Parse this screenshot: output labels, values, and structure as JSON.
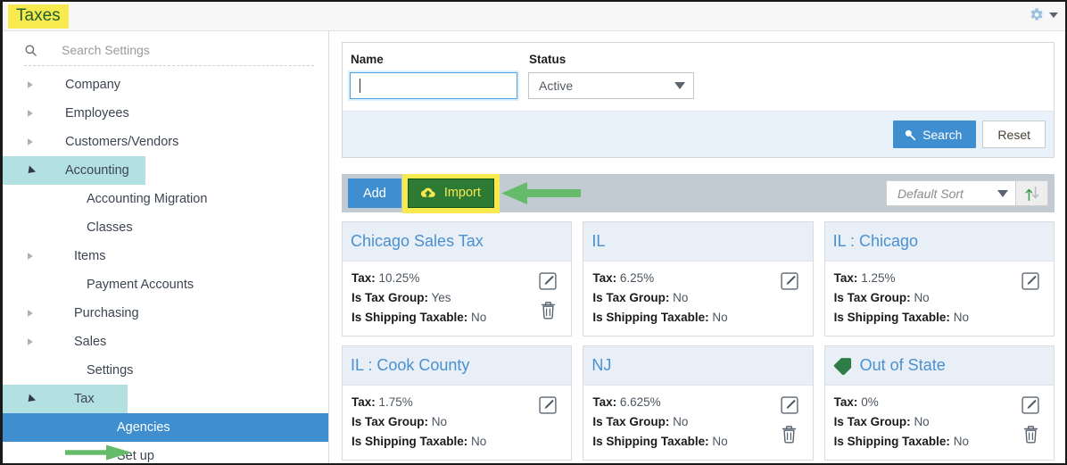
{
  "titlebar": {
    "title": "Taxes",
    "gear_icon": "gear-icon",
    "caret_icon": "chevron-down-icon"
  },
  "sidebar": {
    "search": {
      "icon": "search-icon",
      "placeholder": "Search Settings"
    },
    "items": [
      {
        "label": "Company",
        "level": 0,
        "twisty": "collapsed",
        "state": "none"
      },
      {
        "label": "Employees",
        "level": 0,
        "twisty": "collapsed",
        "state": "none"
      },
      {
        "label": "Customers/Vendors",
        "level": 0,
        "twisty": "collapsed",
        "state": "none"
      },
      {
        "label": "Accounting",
        "level": 0,
        "twisty": "expanded",
        "state": "soft"
      },
      {
        "label": "Accounting Migration",
        "level": 1,
        "twisty": "none",
        "state": "none"
      },
      {
        "label": "Classes",
        "level": 1,
        "twisty": "none",
        "state": "none"
      },
      {
        "label": "Items",
        "level": 1,
        "twisty": "collapsed",
        "state": "none"
      },
      {
        "label": "Payment Accounts",
        "level": 1,
        "twisty": "none",
        "state": "none"
      },
      {
        "label": "Purchasing",
        "level": 1,
        "twisty": "collapsed",
        "state": "none"
      },
      {
        "label": "Sales",
        "level": 1,
        "twisty": "collapsed",
        "state": "none"
      },
      {
        "label": "Settings",
        "level": 1,
        "twisty": "none",
        "state": "none"
      },
      {
        "label": "Tax",
        "level": 1,
        "twisty": "expanded",
        "state": "soft-narrow"
      },
      {
        "label": "Agencies",
        "level": 2,
        "twisty": "none",
        "state": "strong"
      },
      {
        "label": "Set up",
        "level": 2,
        "twisty": "none",
        "state": "none"
      }
    ]
  },
  "search_panel": {
    "name_label": "Name",
    "name_value": "",
    "status_label": "Status",
    "status_value": "Active",
    "search_button": "Search",
    "search_icon": "magnifier-icon",
    "reset_button": "Reset"
  },
  "toolbar": {
    "add_label": "Add",
    "import_label": "Import",
    "import_icon": "cloud-upload-icon",
    "sort_value": "Default Sort",
    "sort_caret_icon": "chevron-down-icon",
    "sort_toggle_icon": "sort-updown-icon"
  },
  "annotations": {
    "highlight_color": "#f8e94e",
    "arrow_color": "#66bb6a",
    "title_highlight": "Taxes",
    "import_highlight": "Import",
    "arrow_to_import": "arrow-pointing-left-at-import",
    "arrow_to_agencies": "arrow-pointing-right-at-agencies"
  },
  "cards": [
    {
      "title": "Chicago Sales Tax",
      "has_tag": false,
      "tax_label": "Tax:",
      "tax_value": "10.25%",
      "group_label": "Is Tax Group:",
      "group_value": "Yes",
      "ship_label": "Is Shipping Taxable:",
      "ship_value": "No",
      "edit_icon": "edit-pencil-icon",
      "has_delete": true,
      "delete_icon": "trash-icon"
    },
    {
      "title": "IL",
      "has_tag": false,
      "tax_label": "Tax:",
      "tax_value": "6.25%",
      "group_label": "Is Tax Group:",
      "group_value": "No",
      "ship_label": "Is Shipping Taxable:",
      "ship_value": "No",
      "edit_icon": "edit-pencil-icon",
      "has_delete": false,
      "delete_icon": ""
    },
    {
      "title": "IL : Chicago",
      "has_tag": false,
      "tax_label": "Tax:",
      "tax_value": "1.25%",
      "group_label": "Is Tax Group:",
      "group_value": "No",
      "ship_label": "Is Shipping Taxable:",
      "ship_value": "No",
      "edit_icon": "edit-pencil-icon",
      "has_delete": false,
      "delete_icon": ""
    },
    {
      "title": "IL : Cook County",
      "has_tag": false,
      "tax_label": "Tax:",
      "tax_value": "1.75%",
      "group_label": "Is Tax Group:",
      "group_value": "No",
      "ship_label": "Is Shipping Taxable:",
      "ship_value": "No",
      "edit_icon": "edit-pencil-icon",
      "has_delete": false,
      "delete_icon": ""
    },
    {
      "title": "NJ",
      "has_tag": false,
      "tax_label": "Tax:",
      "tax_value": "6.625%",
      "group_label": "Is Tax Group:",
      "group_value": "No",
      "ship_label": "Is Shipping Taxable:",
      "ship_value": "No",
      "edit_icon": "edit-pencil-icon",
      "has_delete": true,
      "delete_icon": "trash-icon"
    },
    {
      "title": "Out of State",
      "has_tag": true,
      "tag_icon": "tag-label-icon",
      "tax_label": "Tax:",
      "tax_value": "0%",
      "group_label": "Is Tax Group:",
      "group_value": "No",
      "ship_label": "Is Shipping Taxable:",
      "ship_value": "No",
      "edit_icon": "edit-pencil-icon",
      "has_delete": true,
      "delete_icon": "trash-icon"
    }
  ]
}
